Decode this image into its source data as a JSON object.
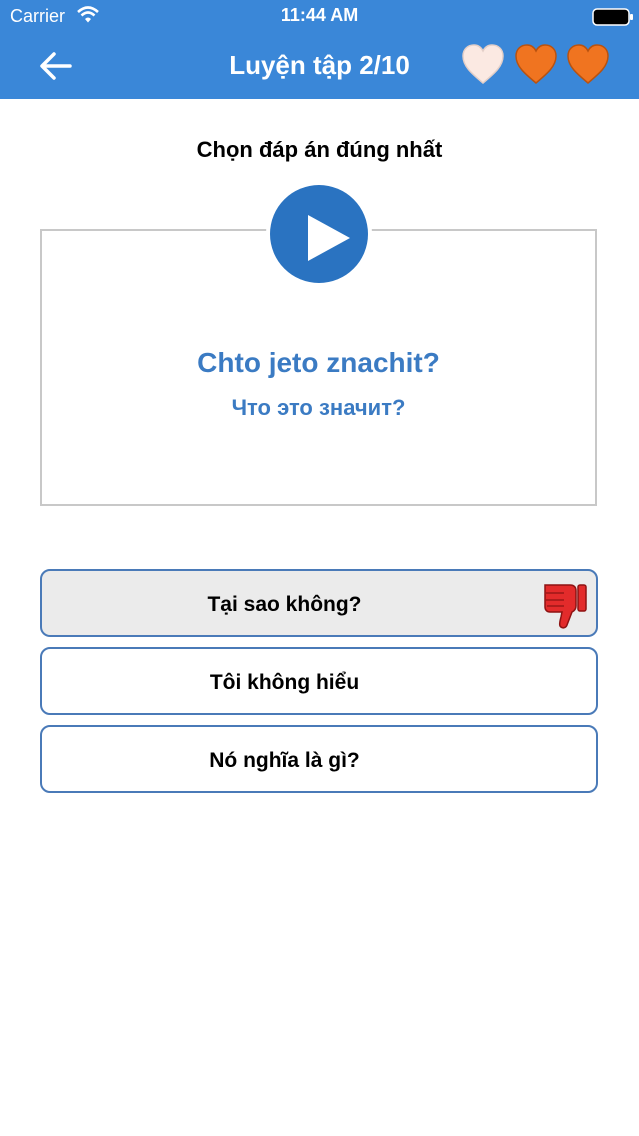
{
  "status": {
    "carrier": "Carrier",
    "time": "11:44 AM"
  },
  "header": {
    "title": "Luyện tập 2/10",
    "hearts": [
      "empty",
      "full",
      "full"
    ],
    "colors": {
      "bar": "#3a87d8",
      "heart_full": "#f07420",
      "heart_empty": "#fbe9e2"
    }
  },
  "question": {
    "instruction": "Chọn đáp án đúng nhất",
    "latin": "Chto jeto znachit?",
    "cyrillic": "Что это значит?"
  },
  "answers": [
    {
      "label": "Tại sao không?",
      "state": "wrong",
      "icon": "thumbs-down-icon"
    },
    {
      "label": "Tôi không hiểu"
    },
    {
      "label": "Nó nghĩa là gì?"
    }
  ]
}
